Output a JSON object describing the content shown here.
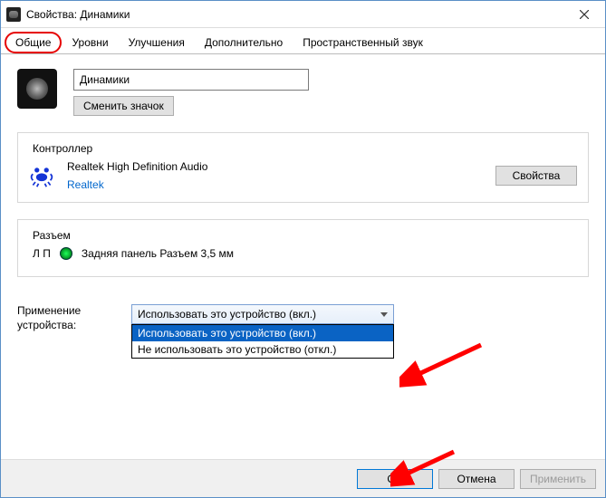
{
  "window": {
    "title": "Свойства: Динамики"
  },
  "tabs": {
    "general": "Общие",
    "levels": "Уровни",
    "enhancements": "Улучшения",
    "advanced": "Дополнительно",
    "spatial": "Пространственный звук"
  },
  "device": {
    "name_value": "Динамики",
    "change_icon_btn": "Сменить значок"
  },
  "controller": {
    "group_title": "Контроллер",
    "name": "Realtek High Definition Audio",
    "vendor": "Realtek",
    "properties_btn": "Свойства"
  },
  "jack": {
    "group_title": "Разъем",
    "channel": "Л П",
    "desc": "Задняя панель Разъем 3,5 мм"
  },
  "usage": {
    "label": "Применение устройства:",
    "selected": "Использовать это устройство (вкл.)",
    "options": {
      "on": "Использовать это устройство (вкл.)",
      "off": "Не использовать это устройство (откл.)"
    }
  },
  "footer": {
    "ok": "OK",
    "cancel": "Отмена",
    "apply": "Применить"
  }
}
